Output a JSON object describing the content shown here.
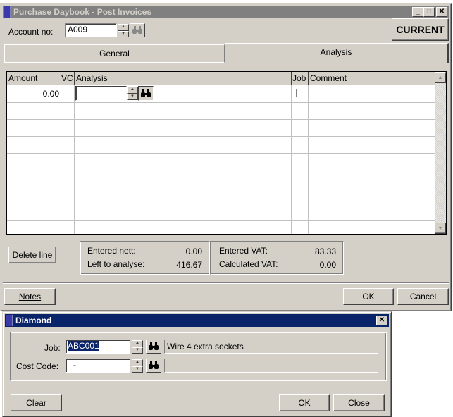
{
  "main_window": {
    "title": "Purchase Daybook - Post Invoices",
    "title_buttons": {
      "minimize": "_",
      "maximize": "□",
      "close": "✕"
    },
    "account_label": "Account no:",
    "account_value": "A009",
    "current_button": "CURRENT",
    "tabs": [
      {
        "label": "General",
        "active": false
      },
      {
        "label": "Analysis",
        "active": true
      }
    ],
    "grid": {
      "columns": [
        "Amount",
        "VC",
        "Analysis",
        "",
        "Job",
        "Comment"
      ],
      "rows": [
        {
          "amount": "0.00",
          "vc": "",
          "analysis": "",
          "desc": "",
          "job": false,
          "comment": ""
        }
      ],
      "empty_rows": 8
    },
    "delete_line_button": "Delete line",
    "totals": {
      "entered_nett_label": "Entered nett:",
      "entered_nett_value": "0.00",
      "left_to_analyse_label": "Left to analyse:",
      "left_to_analyse_value": "416.67",
      "entered_vat_label": "Entered VAT:",
      "entered_vat_value": "83.33",
      "calculated_vat_label": "Calculated VAT:",
      "calculated_vat_value": "0.00"
    },
    "notes_button": "Notes",
    "ok_button": "OK",
    "cancel_button": "Cancel"
  },
  "dialog": {
    "title": "Diamond",
    "close": "✕",
    "job_label": "Job:",
    "job_value": "ABC001",
    "job_description": "Wire 4 extra sockets",
    "cost_code_label": "Cost Code:",
    "cost_code_value": "-",
    "cost_code_description": "",
    "clear_button": "Clear",
    "ok_button": "OK",
    "close_button": "Close"
  }
}
